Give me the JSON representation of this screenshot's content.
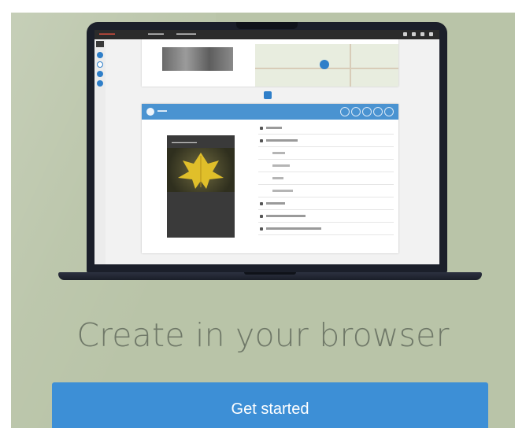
{
  "hero": {
    "headline": "Create in your browser",
    "cta_label": "Get started"
  },
  "colors": {
    "background": "#b9c4a8",
    "button": "#3d8fd6",
    "headline_text": "#6f7868"
  },
  "icons": [
    "laptop-illustration",
    "app-toolbar-icons",
    "map-pin-icon",
    "add-icon"
  ]
}
